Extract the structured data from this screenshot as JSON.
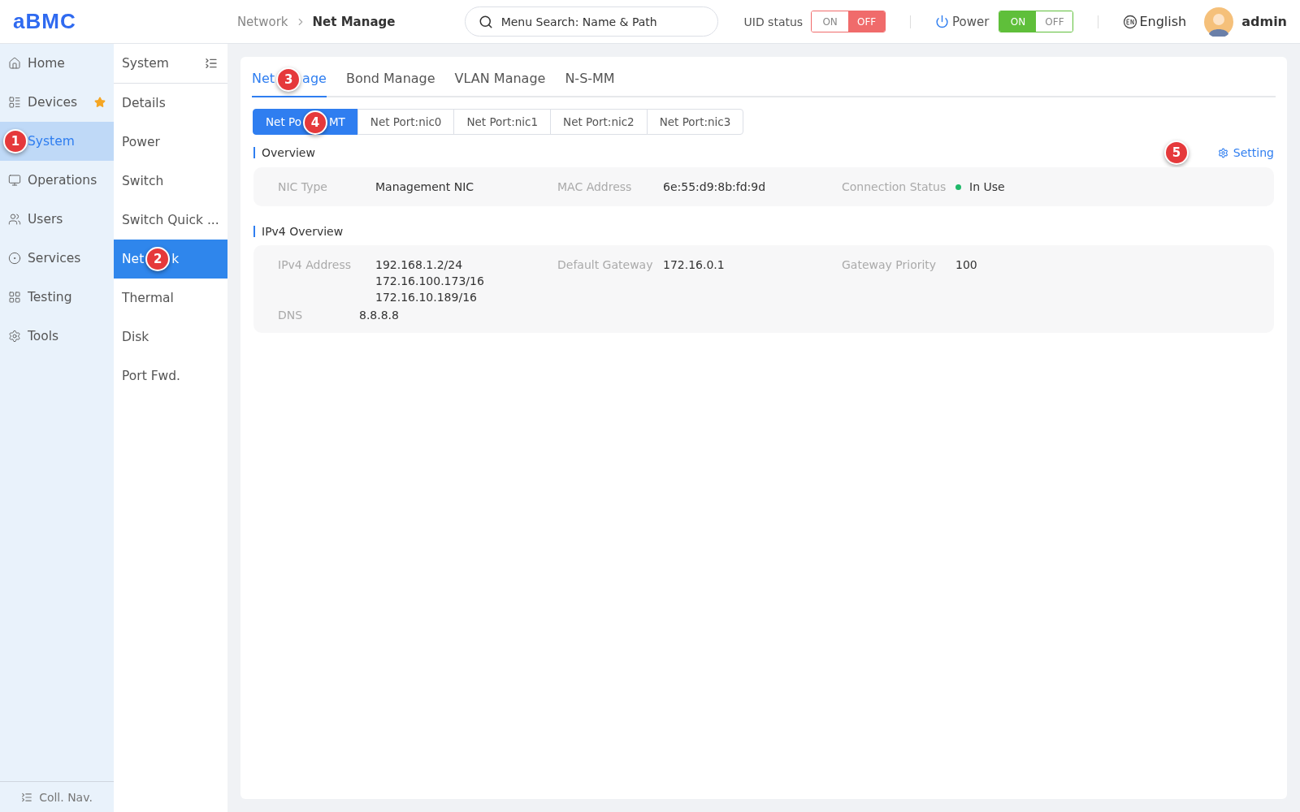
{
  "header": {
    "logo": "aBMC",
    "breadcrumb": [
      "Network",
      "Net Manage"
    ],
    "search": {
      "placeholder": "Menu Search: Name & Path"
    },
    "uid_status": {
      "label": "UID status",
      "options": [
        {
          "label": "ON",
          "selected": false
        },
        {
          "label": "OFF",
          "selected": true
        }
      ]
    },
    "power": {
      "label": "Power",
      "options": [
        {
          "label": "ON",
          "selected": true
        },
        {
          "label": "OFF",
          "selected": false
        }
      ]
    },
    "language": "English",
    "user": "admin"
  },
  "nav": {
    "items": [
      {
        "label": "Home",
        "selected": false,
        "starred": false
      },
      {
        "label": "Devices",
        "selected": false,
        "starred": true
      },
      {
        "label": "System",
        "selected": true,
        "starred": false,
        "callout": "1"
      },
      {
        "label": "Operations",
        "selected": false,
        "starred": false
      },
      {
        "label": "Users",
        "selected": false,
        "starred": false
      },
      {
        "label": "Services",
        "selected": false,
        "starred": false
      },
      {
        "label": "Testing",
        "selected": false,
        "starred": false
      },
      {
        "label": "Tools",
        "selected": false,
        "starred": false
      }
    ],
    "collapse": "Coll. Nav."
  },
  "subnav": {
    "title": "System",
    "items": [
      {
        "label": "Details",
        "selected": false
      },
      {
        "label": "Power",
        "selected": false
      },
      {
        "label": "Switch",
        "selected": false
      },
      {
        "label": "Switch Quick ...",
        "selected": false
      },
      {
        "label_parts": [
          "Net",
          "k"
        ],
        "selected": true,
        "callout": "2"
      },
      {
        "label": "Thermal",
        "selected": false
      },
      {
        "label": "Disk",
        "selected": false
      },
      {
        "label": "Port Fwd.",
        "selected": false
      }
    ]
  },
  "tabs": [
    {
      "label_parts": [
        "Net",
        "age"
      ],
      "selected": true,
      "callout": "3"
    },
    {
      "label": "Bond Manage",
      "selected": false
    },
    {
      "label": "VLAN Manage",
      "selected": false
    },
    {
      "label": "N-S-MM",
      "selected": false
    }
  ],
  "ports": [
    {
      "label_parts": [
        "Net Po",
        "MT"
      ],
      "selected": true,
      "callout": "4"
    },
    {
      "label": "Net Port:nic0",
      "selected": false
    },
    {
      "label": "Net Port:nic1",
      "selected": false
    },
    {
      "label": "Net Port:nic2",
      "selected": false
    },
    {
      "label": "Net Port:nic3",
      "selected": false
    }
  ],
  "overview": {
    "title": "Overview",
    "setting": "Setting",
    "setting_callout": "5",
    "fields": [
      {
        "label": "NIC Type",
        "values": [
          "Management NIC"
        ]
      },
      {
        "label": "MAC Address",
        "values": [
          "6e:55:d9:8b:fd:9d"
        ]
      },
      {
        "label": "Connection Status",
        "values": [
          "In Use"
        ],
        "color": "#20b96a"
      }
    ]
  },
  "ipv4": {
    "title": "IPv4 Overview",
    "fields": [
      {
        "label": "IPv4 Address",
        "values": [
          "192.168.1.2/24",
          "172.16.100.173/16",
          "172.16.10.189/16"
        ]
      },
      {
        "label": "Default Gateway",
        "values": [
          "172.16.0.1"
        ]
      },
      {
        "label": "Gateway Priority",
        "values": [
          "100"
        ]
      }
    ],
    "dns": {
      "label": "DNS",
      "values": [
        "8.8.8.8"
      ]
    }
  }
}
